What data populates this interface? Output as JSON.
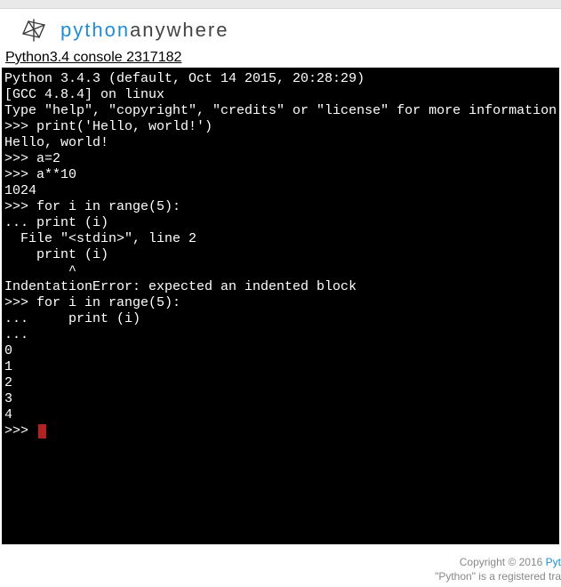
{
  "brand": {
    "part1": "python",
    "part2": "anywhere"
  },
  "console_title": "Python3.4 console 2317182",
  "terminal_lines": [
    "Python 3.4.3 (default, Oct 14 2015, 20:28:29)",
    "[GCC 4.8.4] on linux",
    "Type \"help\", \"copyright\", \"credits\" or \"license\" for more information.",
    ">>> print('Hello, world!')",
    "Hello, world!",
    ">>> a=2",
    ">>> a**10",
    "1024",
    ">>> for i in range(5):",
    "... print (i)",
    "  File \"<stdin>\", line 2",
    "    print (i)",
    "        ^",
    "IndentationError: expected an indented block",
    ">>> for i in range(5):",
    "...     print (i)",
    "...",
    "0",
    "1",
    "2",
    "3",
    "4",
    ">>> "
  ],
  "footer": {
    "copyright": "Copyright © 2016 ",
    "link": "Pyt",
    "trademark": "\"Python\" is a registered tra"
  }
}
